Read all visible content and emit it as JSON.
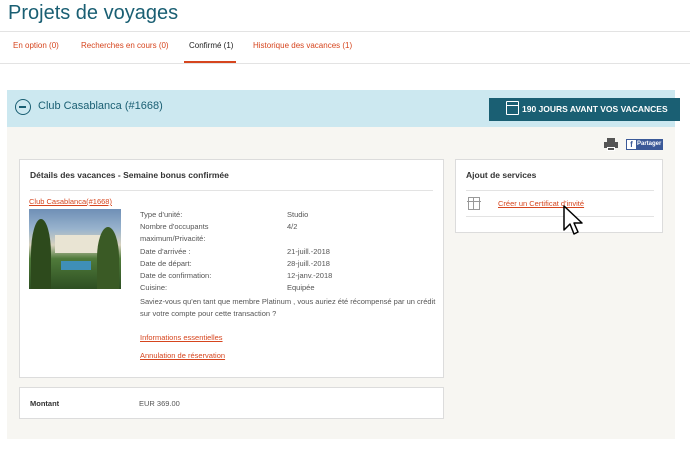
{
  "page": {
    "title": "Projets de voyages"
  },
  "tabs": [
    {
      "label": "En option (0)"
    },
    {
      "label": "Recherches en cours (0)"
    },
    {
      "label": "Confirmé (1)"
    },
    {
      "label": "Historique des vacances (1)"
    }
  ],
  "active_tab": "Confirmé (1)",
  "banner": {
    "club_title": "Club Casablanca (#1668)",
    "days_badge": "190 JOURS AVANT VOS VACANCES"
  },
  "toolbar": {
    "share_label": "Partager",
    "share_icon": "facebook-icon",
    "print_icon": "printer-icon"
  },
  "details": {
    "heading": "Détails des vacances - Semaine bonus confirmée",
    "club_link": "Club Casablanca(#1668)",
    "rows": [
      {
        "label": "Type d'unité:",
        "value": "Studio"
      },
      {
        "label": "Nombre d'occupants",
        "value": "4/2"
      },
      {
        "label": "maximum/Privacité:",
        "value": ""
      },
      {
        "label": "Date d'arrivée :",
        "value": "21-juill.-2018"
      },
      {
        "label": "Date de départ:",
        "value": "28-juill.-2018"
      },
      {
        "label": "Date de confirmation:",
        "value": "12-janv.-2018"
      },
      {
        "label": "Cuisine:",
        "value": "Equipée"
      }
    ],
    "platinum_text": "Saviez-vous qu'en tant que membre Platinum , vous auriez été récompensé par un crédit sur votre compte pour cette transaction ?",
    "links": {
      "essential_info": "Informations essentielles",
      "cancel": "Annulation de réservation"
    }
  },
  "amount": {
    "label": "Montant",
    "value": "EUR 369.00"
  },
  "services": {
    "heading": "Ajout de services",
    "cert_link": "Créer un Certificat d'invité"
  },
  "colors": {
    "accent": "#d6451e",
    "brand": "#1a5f73",
    "banner_bg": "#cce8f0"
  }
}
